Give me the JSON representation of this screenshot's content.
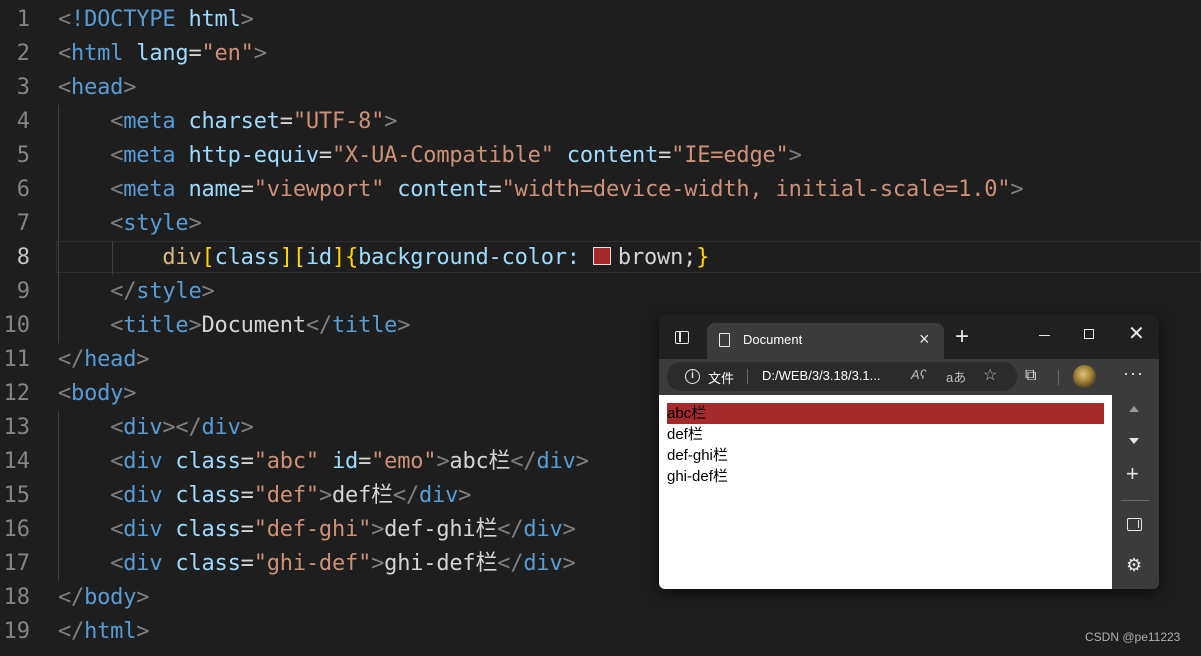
{
  "editor": {
    "active_line": "8",
    "lines": [
      {
        "n": "1"
      },
      {
        "n": "2"
      },
      {
        "n": "3"
      },
      {
        "n": "4"
      },
      {
        "n": "5"
      },
      {
        "n": "6"
      },
      {
        "n": "7"
      },
      {
        "n": "8"
      },
      {
        "n": "9"
      },
      {
        "n": "10"
      },
      {
        "n": "11"
      },
      {
        "n": "12"
      },
      {
        "n": "13"
      },
      {
        "n": "14"
      },
      {
        "n": "15"
      },
      {
        "n": "16"
      },
      {
        "n": "17"
      },
      {
        "n": "18"
      },
      {
        "n": "19"
      }
    ],
    "tokens": {
      "doctype": "!DOCTYPE",
      "html": "html",
      "lang": "lang",
      "en": "\"en\"",
      "head": "head",
      "meta": "meta",
      "charset": "charset",
      "utf8": "\"UTF-8\"",
      "http_equiv": "http-equiv",
      "x_ua": "\"X-UA-Compatible\"",
      "content": "content",
      "ie_edge": "\"IE=edge\"",
      "name": "name",
      "viewport": "\"viewport\"",
      "viewport_content": "\"width=device-width, initial-scale=1.0\"",
      "style": "style",
      "selector_div": "div",
      "selector_class": "class",
      "selector_id": "id",
      "prop": "background-color:",
      "value": "brown;",
      "title": "title",
      "title_text": "Document",
      "body": "body",
      "div": "div",
      "class": "class",
      "id": "id",
      "abc": "\"abc\"",
      "emo": "\"emo\"",
      "abc_text": "abc栏",
      "def": "\"def\"",
      "def_text": "def栏",
      "def_ghi": "\"def-ghi\"",
      "def_ghi_text": "def-ghi栏",
      "ghi_def": "\"ghi-def\"",
      "ghi_def_text": "ghi-def栏"
    },
    "swatch_color": "#a52a2a"
  },
  "browser": {
    "tab_title": "Document",
    "tab_close": "×",
    "new_tab": "+",
    "win_close": "✕",
    "address": {
      "info": "i",
      "scheme_label": "文件",
      "url": "D:/WEB/3/3.18/3.1..."
    },
    "toolbar_icons": {
      "read_aloud": "Aʕ",
      "translate": "aあ",
      "favorites": "☆",
      "extensions": "⧉",
      "more": "···"
    },
    "page": {
      "divs": [
        "abc栏",
        "def栏",
        "def-ghi栏",
        "ghi-def栏"
      ],
      "highlight_color": "#a52a2a"
    },
    "sidebar": {
      "add": "+",
      "settings": "⚙"
    }
  },
  "watermark": "CSDN @pe11223"
}
